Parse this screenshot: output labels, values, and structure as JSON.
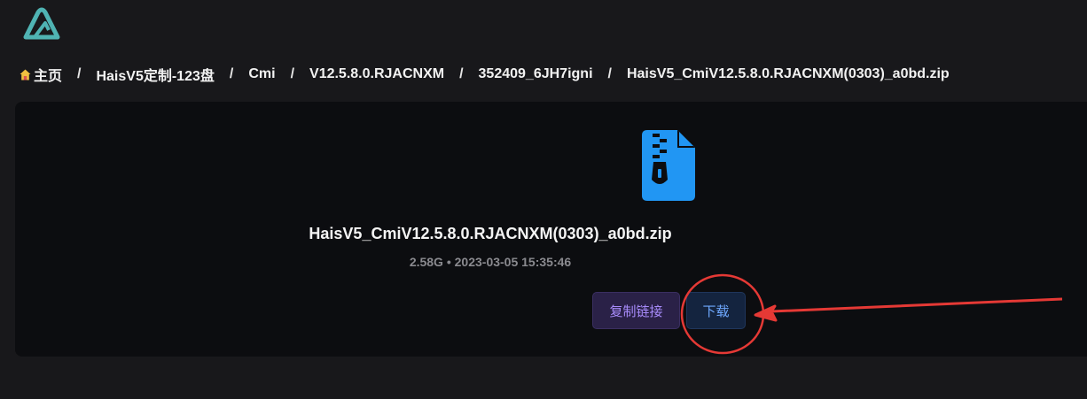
{
  "logo": {
    "icon": "alist-logo-icon",
    "color": "#4fb3b3"
  },
  "breadcrumb": {
    "items": [
      {
        "label": "主页",
        "icon": "home-icon"
      },
      {
        "label": "HaisV5定制-123盘"
      },
      {
        "label": "Cmi"
      },
      {
        "label": "V12.5.8.0.RJACNXM"
      },
      {
        "label": "352409_6JH7igni"
      },
      {
        "label": "HaisV5_CmiV12.5.8.0.RJACNXM(0303)_a0bd.zip"
      }
    ],
    "separator": "/"
  },
  "file": {
    "icon": "zip-file-icon",
    "icon_color": "#2196f3",
    "name": "HaisV5_CmiV12.5.8.0.RJACNXM(0303)_a0bd.zip",
    "meta": "2.58G • 2023-03-05 15:35:46"
  },
  "actions": {
    "copy_link_label": "复制链接",
    "download_label": "下载"
  },
  "annotation": {
    "color": "#e53935",
    "shapes": [
      "circle",
      "arrow"
    ]
  }
}
